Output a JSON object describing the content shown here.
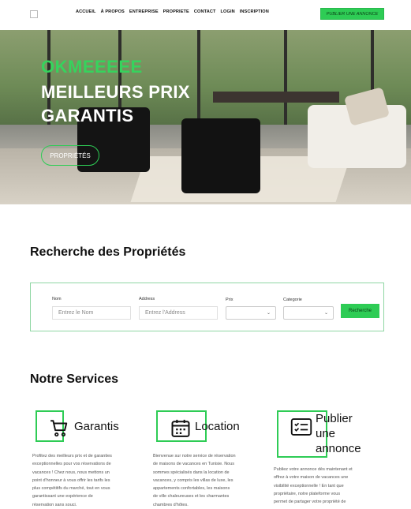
{
  "header": {
    "nav": [
      "ACCUEIL",
      "À PROPOS",
      "ENTREPRISE",
      "PROPRIETE",
      "CONTACT",
      "LOGIN",
      "INSCRIPTION"
    ],
    "publish_label": "PUBLIER UNE ANNONCE"
  },
  "hero": {
    "accent": "OKMEEEEE",
    "title_line1": "MEILLEURS PRIX",
    "title_line2": "GARANTIS",
    "button_label": "PROPRIÉTÉS"
  },
  "search": {
    "title": "Recherche des Propriétés",
    "nom_label": "Nom",
    "nom_placeholder": "Entrez le Nom",
    "address_label": "Address",
    "address_placeholder": "Entrez l'Address",
    "prix_label": "Prix",
    "categorie_label": "Categorie",
    "button_label": "Recherche"
  },
  "services": {
    "title": "Notre Services",
    "items": [
      {
        "icon": "cart-icon",
        "title": "Garantis",
        "text": [
          "Profitez des meilleurs prix et de garanties",
          "exceptionnelles pour vos réservations de",
          "vacances ! Chez nous, nous mettons un",
          "point d'honneur à vous offrir les tarifs les",
          "plus compétitifs du marché, tout en vous",
          "garantissant une expérience de",
          "réservation sans souci."
        ]
      },
      {
        "icon": "calendar-icon",
        "title": "Location",
        "text": [
          "Bienvenue sur notre service de réservation",
          "de maisons de vacances en Tunisie. Nous",
          "sommes spécialisés dans la location de",
          "vacances, y compris les villas de luxe, les",
          "appartements confortables, les maisons",
          "de ville chaleureuses et les charmantes",
          "chambres d'hôtes."
        ]
      },
      {
        "icon": "card-list-icon",
        "title_lines": [
          "Publier",
          "une",
          "annonce"
        ],
        "text": [
          "Publiez votre annonce dès maintenant et",
          "offrez à votre maison de vacances une",
          "visibilité exceptionnelle ! En tant que",
          "propriétaire, notre plateforme vous",
          "permet de partager votre propriété de"
        ]
      }
    ]
  },
  "colors": {
    "accent": "#2ecc55"
  }
}
